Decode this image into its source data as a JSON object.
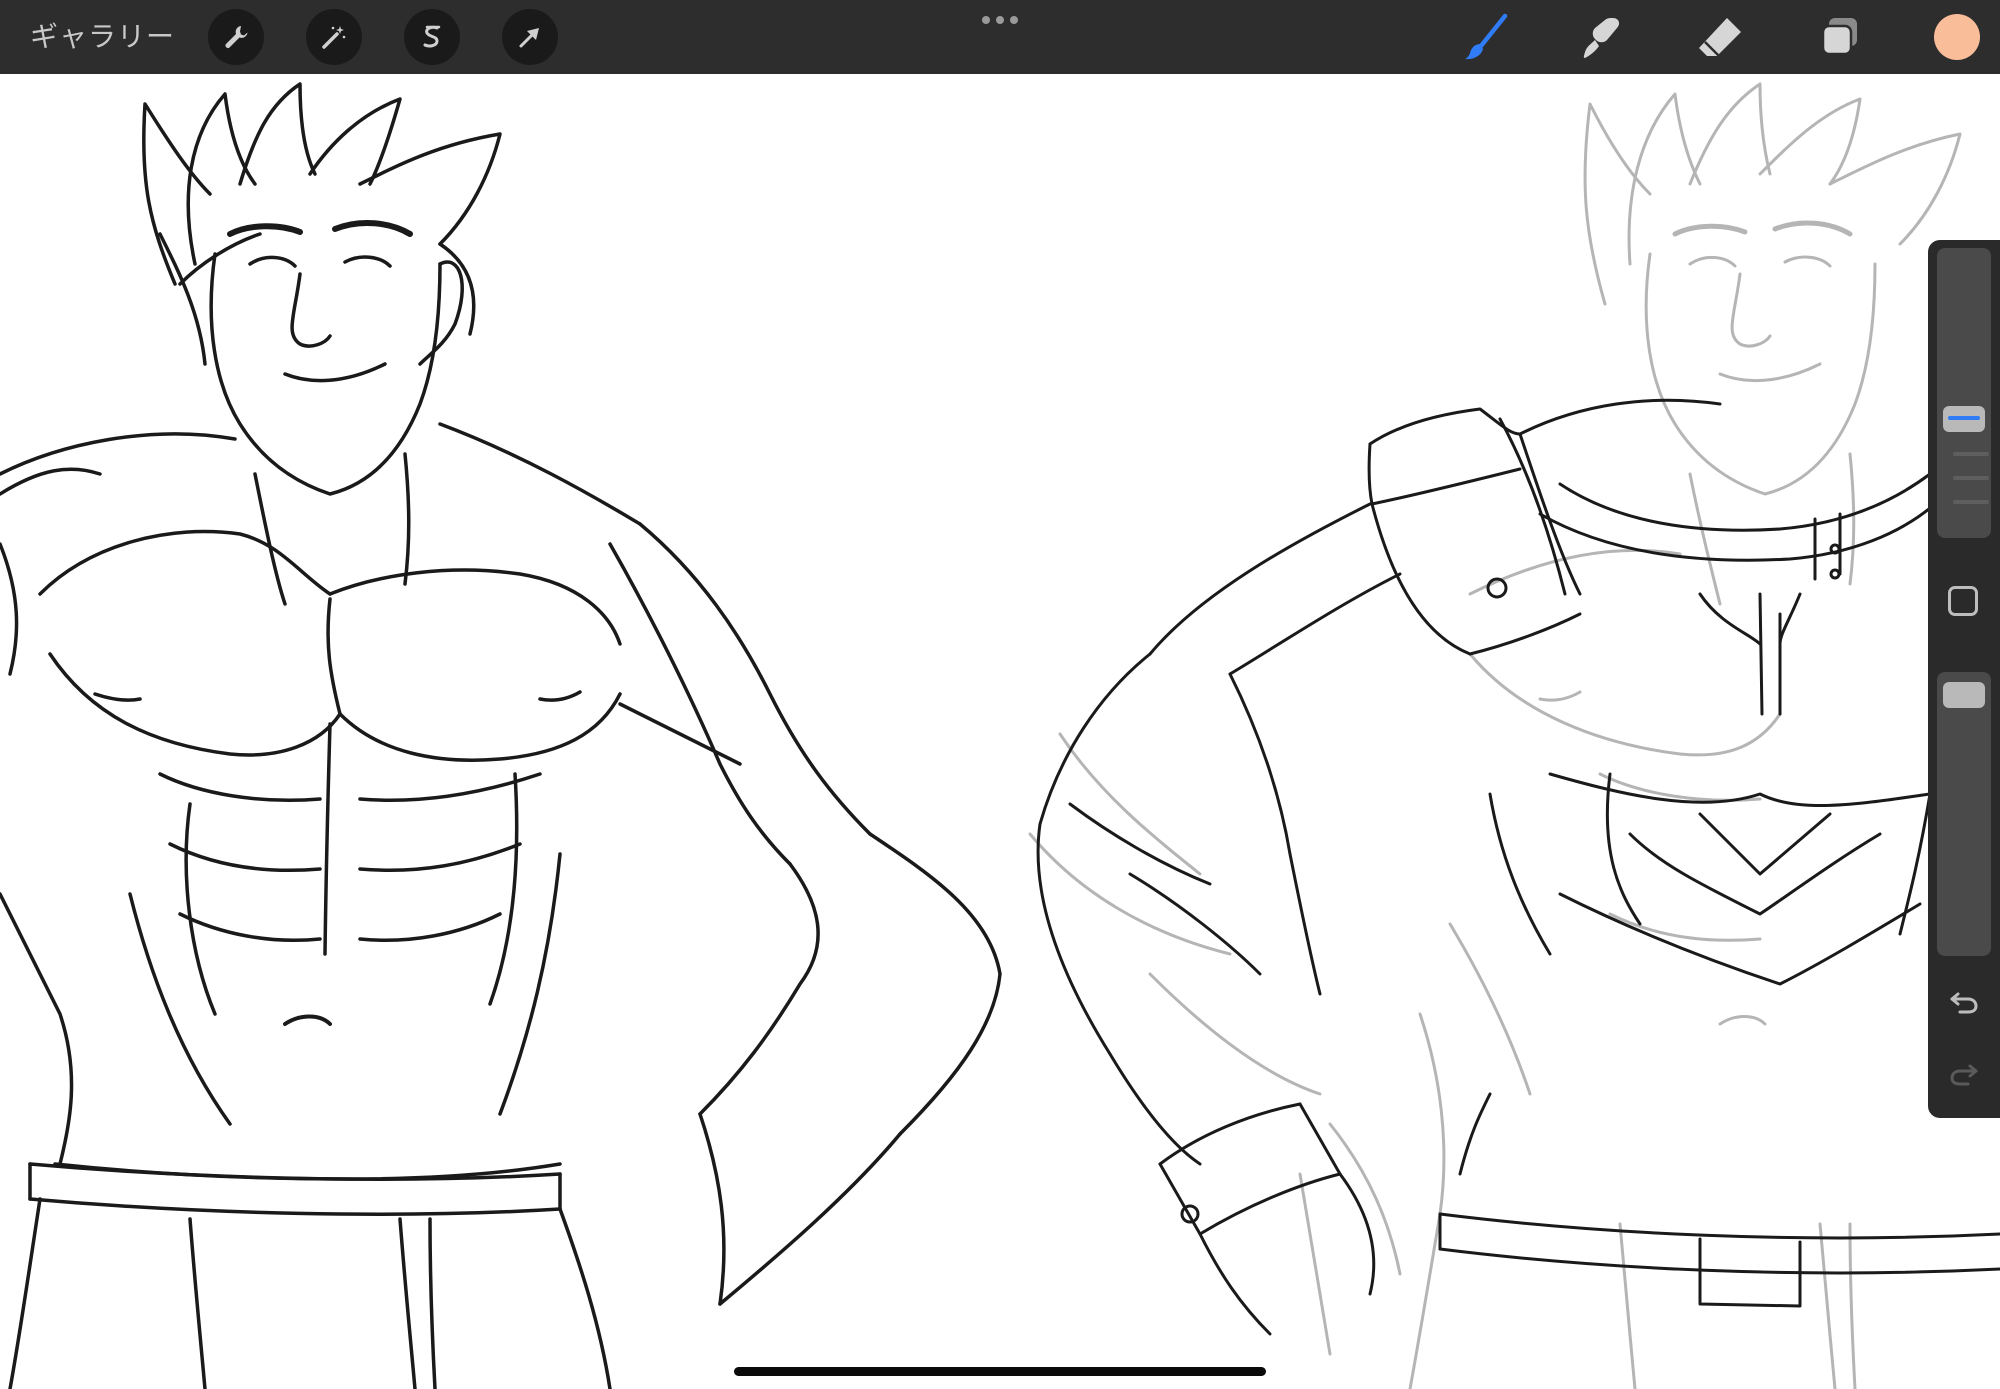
{
  "toolbar": {
    "gallery_label": "ギャラリー",
    "left_tools": [
      {
        "name": "actions",
        "icon": "wrench-icon"
      },
      {
        "name": "adjustments",
        "icon": "magic-wand-icon"
      },
      {
        "name": "selection",
        "icon": "selection-icon"
      },
      {
        "name": "transform",
        "icon": "arrow-cursor-icon"
      }
    ],
    "more_icon": "more-dots-icon",
    "right_tools": [
      {
        "name": "brush",
        "icon": "brush-icon",
        "active": true
      },
      {
        "name": "smudge",
        "icon": "smudge-icon",
        "active": false
      },
      {
        "name": "eraser",
        "icon": "eraser-icon",
        "active": false
      },
      {
        "name": "layers",
        "icon": "layers-icon",
        "active": false
      }
    ],
    "current_color": "#f9bd9a",
    "active_color": "#2f7cf6"
  },
  "sidebar": {
    "brush_size_level": 0.45,
    "opacity_level": 0.95,
    "modify_icon": "square-icon",
    "undo_icon": "undo-icon",
    "redo_icon": "redo-icon"
  },
  "canvas": {
    "description_colors": {
      "ink": "#1a1a1a",
      "sketch": "#b0b0b0"
    }
  }
}
